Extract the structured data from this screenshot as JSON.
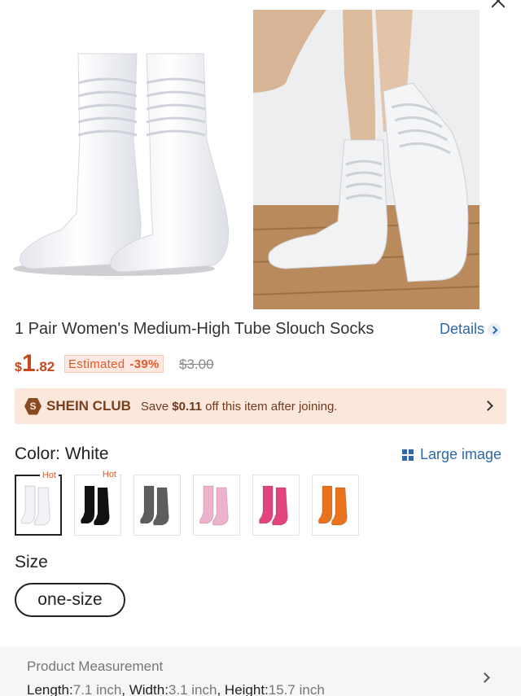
{
  "product": {
    "title": "1 Pair Women's Medium-High Tube Slouch Socks",
    "details_label": "Details"
  },
  "price": {
    "currency": "$",
    "integer": "1",
    "decimal": ".82",
    "estimated_label": "Estimated",
    "discount": "-39%",
    "original": "$3.00"
  },
  "club": {
    "logo_letter": "S",
    "name": "SHEIN CLUB",
    "text_prefix": "Save",
    "amount": "$0.11",
    "text_suffix": "off this item after joining."
  },
  "color": {
    "label": "Color: White",
    "large_image_label": "Large image",
    "swatches": [
      {
        "name": "white",
        "hex": "#f2f3f7",
        "hot": "Hot"
      },
      {
        "name": "black",
        "hex": "#111111",
        "hot": "Hot"
      },
      {
        "name": "gray",
        "hex": "#5e5e60",
        "hot": ""
      },
      {
        "name": "pink",
        "hex": "#efb2cc",
        "hot": ""
      },
      {
        "name": "rose",
        "hex": "#e2457e",
        "hot": ""
      },
      {
        "name": "orange",
        "hex": "#e8731c",
        "hot": ""
      }
    ]
  },
  "size": {
    "label": "Size",
    "option": "one-size"
  },
  "measurement": {
    "title": "Product Measurement",
    "length_label": "Length:",
    "length_value": "7.1 inch",
    "width_label": "Width:",
    "width_value": "3.1 inch",
    "height_label": "Height:",
    "height_value": "15.7 inch"
  },
  "colors": {
    "accent_link": "#2d68a8",
    "price": "#c44a1c",
    "club_bg": "#fbe7dc"
  },
  "icons": [
    "close-icon",
    "chevron-right-icon",
    "grid-icon",
    "shein-club-logo"
  ]
}
